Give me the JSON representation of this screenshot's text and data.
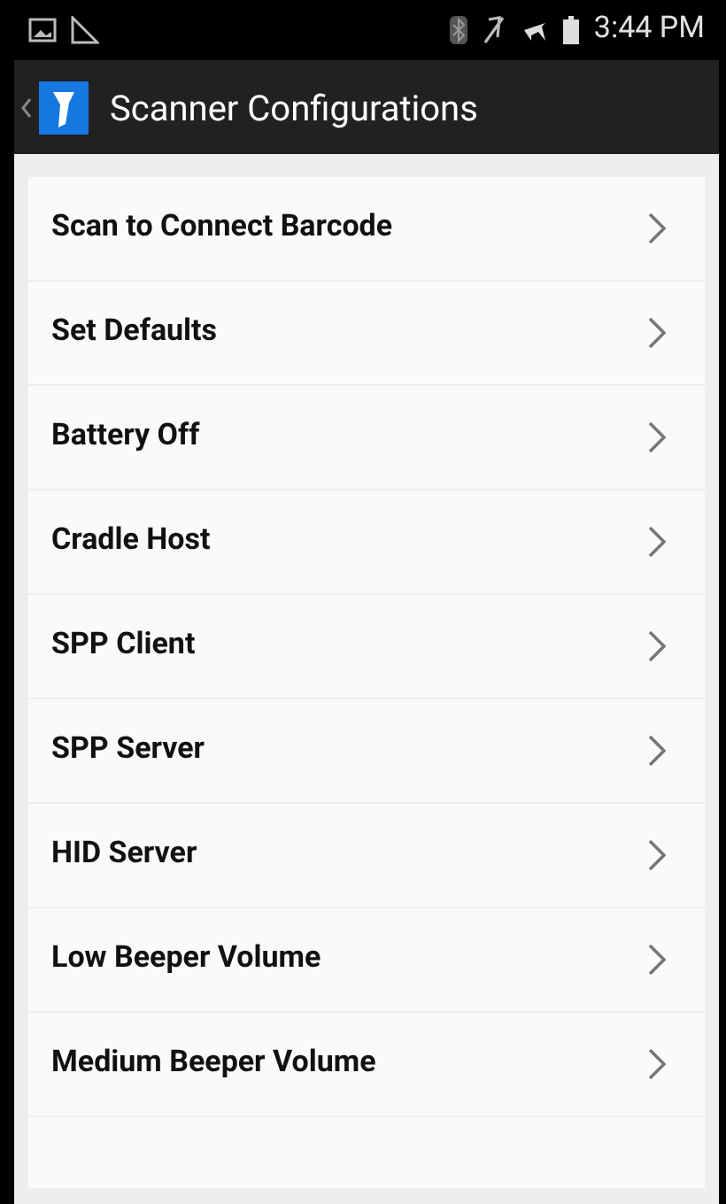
{
  "status_bar": {
    "time": "3:44 PM"
  },
  "action_bar": {
    "title": "Scanner Configurations"
  },
  "items": [
    {
      "label": "Scan to Connect Barcode"
    },
    {
      "label": "Set Defaults"
    },
    {
      "label": "Battery Off"
    },
    {
      "label": "Cradle Host"
    },
    {
      "label": "SPP Client"
    },
    {
      "label": "SPP Server"
    },
    {
      "label": "HID Server"
    },
    {
      "label": "Low Beeper Volume"
    },
    {
      "label": "Medium Beeper Volume"
    }
  ]
}
